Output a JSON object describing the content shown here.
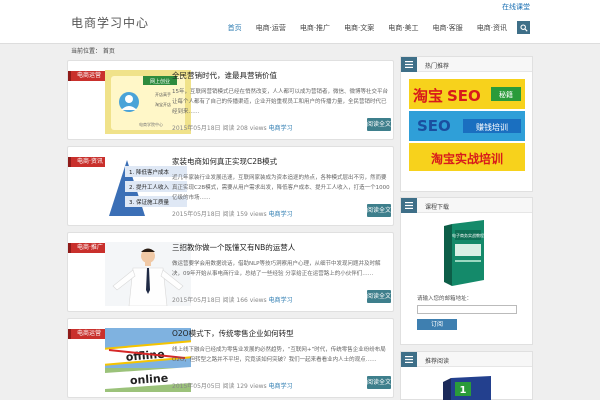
{
  "site": {
    "title": "电商学习中心",
    "top_link": "在线课堂"
  },
  "nav": {
    "items": [
      "首页",
      "电商·运营",
      "电商·推广",
      "电商·文案",
      "电商·美工",
      "电商·客服",
      "电商·资讯"
    ]
  },
  "breadcrumb": "当前位置： 首页",
  "posts": [
    {
      "tag": "电商运营",
      "title": "全民营销时代，谁最具营销价值",
      "excerpt": "15年，互联网营销模式已经在悄然改变，人人都可以成为营销者，微信、微博等社交平台让每个人都有了自己的传播渠道，企业开始重视员工和用户的传播力量，全民营销时代已经到来……",
      "date": "2015年05月18日",
      "views": "阅读 208 views",
      "author": "电商学习",
      "more": "阅读全文"
    },
    {
      "tag": "电商·资讯",
      "title": "家装电商如何真正实现C2B模式",
      "excerpt": "近几年家装行业发展迅速，互联网家装成为资本追逐的热点，各种模式层出不穷，然而要真正实现C2B模式，需要从用户需求出发，降低客户成本、提升工人收入，打造一个1000亿级的市场……",
      "date": "2015年05月18日",
      "views": "阅读 159 views",
      "author": "电商学习",
      "more": "阅读全文"
    },
    {
      "tag": "电商·推广",
      "title": "三招教你做一个既懂又有NB的运营人",
      "excerpt": "做运营要学会用数据说话，借助NLP等技巧洞察用户心理，从细节中发现问题并及时解决，09年开始从事电商行业，总结了一些经验 分享给正在运营路上的小伙伴们……",
      "date": "2015年05月18日",
      "views": "阅读 166 views",
      "author": "电商学习",
      "more": "阅读全文"
    },
    {
      "tag": "电商运营",
      "title": "O2O模式下，传统零售企业如何转型",
      "excerpt": "线上线下融合已经成为零售业发展的必然趋势，“互联网+”时代，传统零售企业纷纷布局O2O，但转型之路并不平坦，究竟该如何突破？我们一起来看看业内人士的观点……",
      "date": "2015年05月05日",
      "views": "阅读 129 views",
      "author": "电商学习",
      "more": "阅读全文"
    }
  ],
  "thumbs": {
    "t1": {
      "badge": "网上创业",
      "name": "开店高手",
      "line1": "淘宝开店",
      "line2": "电商学院中心"
    },
    "t2": {
      "r1": "1. 降低客户成本",
      "r2": "2. 提升工人收入",
      "r3": "3. 保证施工质量"
    },
    "t4": {
      "w1": "offline",
      "w2": "online"
    }
  },
  "widgets": [
    {
      "title": "热门推荐",
      "ad_words": [
        "淘宝",
        "SEO",
        "秘籍",
        "SEO",
        "赚钱培训",
        "淘宝实战培训"
      ]
    },
    {
      "title": "课程下载",
      "box_title": "电子商务实战教程",
      "label": "请输入您的邮箱地址：",
      "input_placeholder": "",
      "button": "订阅"
    },
    {
      "title": "推荐阅读",
      "box_number": "1"
    }
  ],
  "colors": {
    "accent": "#3e6f88",
    "tag_red": "#c9302c",
    "link": "#2a7ab0"
  }
}
